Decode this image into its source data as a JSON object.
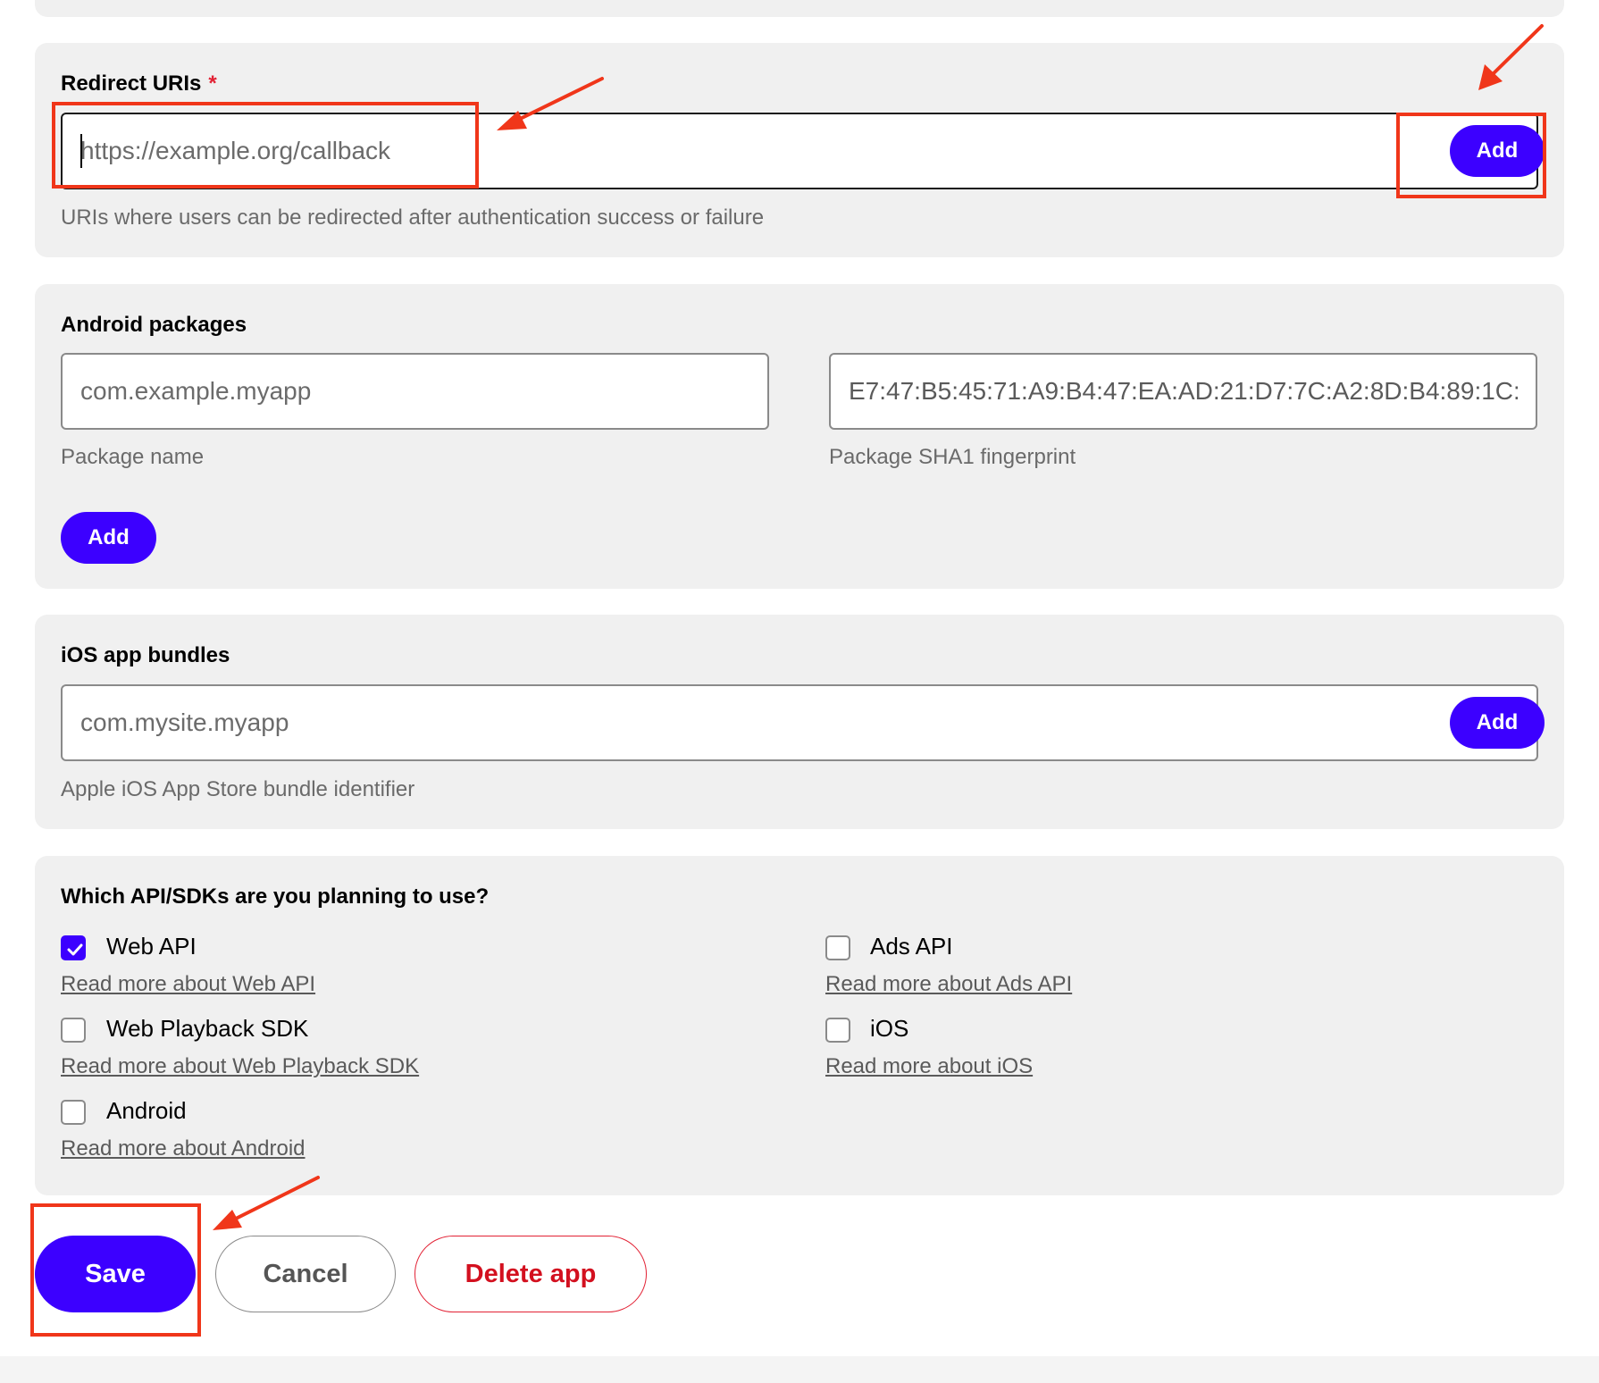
{
  "redirect_uris": {
    "title": "Redirect URIs",
    "required_mark": "*",
    "placeholder": "https://example.org/callback",
    "add_label": "Add",
    "help": "URIs where users can be redirected after authentication success or failure"
  },
  "android_packages": {
    "title": "Android packages",
    "package_name_placeholder": "com.example.myapp",
    "package_name_help": "Package name",
    "fingerprint_placeholder": "E7:47:B5:45:71:A9:B4:47:EA:AD:21:D7:7C:A2:8D:B4:89:1C:",
    "fingerprint_help": "Package SHA1 fingerprint",
    "add_label": "Add"
  },
  "ios_bundles": {
    "title": "iOS app bundles",
    "placeholder": "com.mysite.myapp",
    "add_label": "Add",
    "help": "Apple iOS App Store bundle identifier"
  },
  "apis": {
    "title": "Which API/SDKs are you planning to use?",
    "options": [
      {
        "label": "Web API",
        "link": "Read more about Web API",
        "checked": true
      },
      {
        "label": "Ads API",
        "link": "Read more about Ads API",
        "checked": false
      },
      {
        "label": "Web Playback SDK",
        "link": "Read more about Web Playback SDK",
        "checked": false
      },
      {
        "label": "iOS",
        "link": "Read more about iOS",
        "checked": false
      },
      {
        "label": "Android",
        "link": "Read more about Android",
        "checked": false
      }
    ]
  },
  "actions": {
    "save_label": "Save",
    "cancel_label": "Cancel",
    "delete_label": "Delete app"
  },
  "colors": {
    "accent": "#3c00ff",
    "danger": "#e22134",
    "annotation": "#f0361a",
    "card_bg": "#f0f0f0"
  }
}
